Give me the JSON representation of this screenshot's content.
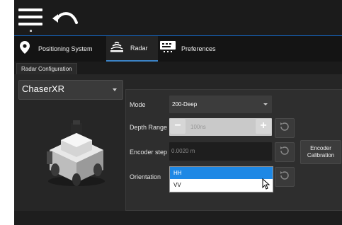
{
  "tabs": [
    {
      "label": "Positioning System",
      "icon": "location-pin-icon"
    },
    {
      "label": "Radar",
      "icon": "radar-waves-icon",
      "active": true
    },
    {
      "label": "Preferences",
      "icon": "keyboard-icon"
    }
  ],
  "subtab": {
    "label": "Radar Configuration"
  },
  "device": {
    "selected": "ChaserXR"
  },
  "form": {
    "mode": {
      "label": "Mode",
      "value": "200-Deep"
    },
    "depth_range": {
      "label": "Depth Range",
      "value": "100ns",
      "minus": "−",
      "plus": "+"
    },
    "encoder_step": {
      "label": "Encoder step",
      "value": "0.0020 m"
    },
    "encoder_calibration": {
      "line1": "Encoder",
      "line2": "Calibration"
    },
    "orientation": {
      "label": "Orientation",
      "options": [
        "HH",
        "VV"
      ],
      "selected": "HH"
    }
  },
  "colors": {
    "accent": "#1565c0",
    "selected": "#1e88e5",
    "background": "#262626"
  }
}
